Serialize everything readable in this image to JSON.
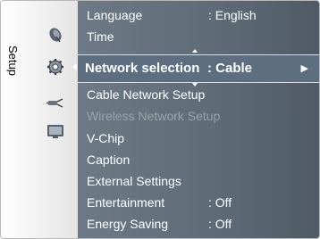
{
  "sidebar": {
    "title": "Setup",
    "icons": [
      "satellite-dish-icon",
      "gear-icon",
      "plug-icon",
      "tv-screen-icon"
    ]
  },
  "menu": {
    "items": [
      {
        "label": "Language",
        "value": ": English",
        "state": "normal"
      },
      {
        "label": "Time",
        "value": "",
        "state": "normal"
      },
      {
        "label": "Network selection",
        "value": ": Cable",
        "state": "selected"
      },
      {
        "label": "Cable Network Setup",
        "value": "",
        "state": "normal"
      },
      {
        "label": "Wireless Network Setup",
        "value": "",
        "state": "disabled"
      },
      {
        "label": "V-Chip",
        "value": "",
        "state": "normal"
      },
      {
        "label": "Caption",
        "value": "",
        "state": "normal"
      },
      {
        "label": "External Settings",
        "value": "",
        "state": "normal"
      },
      {
        "label": "Entertainment",
        "value": ": Off",
        "state": "normal"
      },
      {
        "label": "Energy Saving",
        "value": ": Off",
        "state": "normal"
      }
    ],
    "selected_arrow": "▶"
  },
  "colors": {
    "menu_background": "#5f6c78",
    "highlight": "#5d6e80",
    "text": "#ffffff",
    "disabled_text": "#9aa3ab"
  }
}
